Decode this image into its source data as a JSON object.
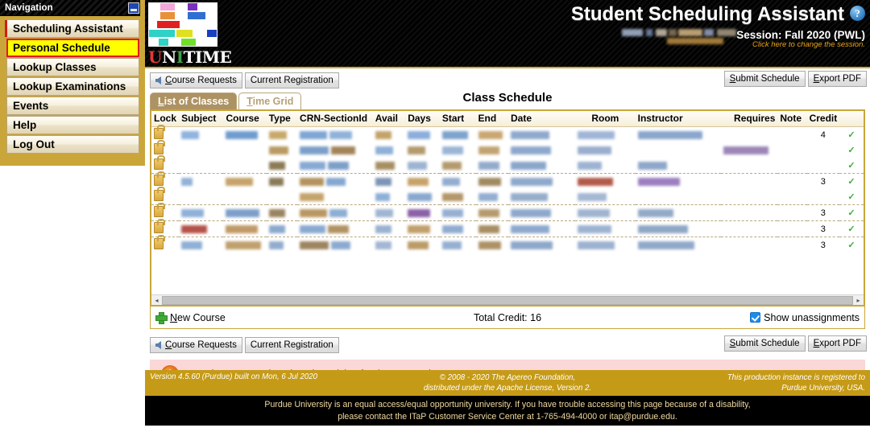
{
  "nav": {
    "title": "Navigation",
    "minimize_icon": "minimize-icon",
    "items": [
      {
        "label": "Scheduling Assistant",
        "selected": false
      },
      {
        "label": "Personal Schedule",
        "selected": true
      },
      {
        "label": "Lookup Classes",
        "selected": false
      },
      {
        "label": "Lookup Examinations",
        "selected": false
      },
      {
        "label": "Events",
        "selected": false
      },
      {
        "label": "Help",
        "selected": false
      },
      {
        "label": "Log Out",
        "selected": false
      }
    ]
  },
  "header": {
    "logo_text_parts": [
      "U",
      "N",
      "I",
      "T",
      "IME"
    ],
    "logo_text": "UniTime",
    "app_title": "Student Scheduling Assistant",
    "help_icon": "?",
    "session_label": "Session: Fall 2020 (PWL)",
    "session_sub": "Click here to change the session.",
    "accent_color": "#caa63a"
  },
  "toolbar_top": {
    "back_icon": "arrow-left-icon",
    "course_requests": "Course Requests",
    "course_requests_accel": "C",
    "current_registration": "Current Registration",
    "submit_schedule": "Submit Schedule",
    "submit_schedule_accel": "S",
    "export_pdf": "Export PDF",
    "export_pdf_accel": "E"
  },
  "tabs": {
    "list_of_classes": "List of Classes",
    "list_of_classes_accel": "L",
    "time_grid": "Time Grid",
    "time_grid_accel": "T",
    "active": "List of Classes"
  },
  "page_title": "Class Schedule",
  "table": {
    "columns": [
      "Lock",
      "Subject",
      "Course",
      "Type",
      "CRN-SectionId",
      "Avail",
      "Days",
      "Start",
      "End",
      "Date",
      "Room",
      "Instructor",
      "Requires",
      "Note",
      "Credit"
    ],
    "rows": [
      {
        "lock": "lock-icon",
        "credit": "4",
        "assigned": "✓",
        "group_start": true
      },
      {
        "lock": "lock-icon",
        "credit": "",
        "assigned": "✓",
        "group_start": false
      },
      {
        "lock": "lock-icon",
        "credit": "",
        "assigned": "✓",
        "group_start": false
      },
      {
        "lock": "lock-icon",
        "credit": "3",
        "assigned": "✓",
        "group_start": true
      },
      {
        "lock": "lock-icon",
        "credit": "",
        "assigned": "✓",
        "group_start": false
      },
      {
        "lock": "lock-icon",
        "credit": "3",
        "assigned": "✓",
        "group_start": true
      },
      {
        "lock": "lock-icon",
        "credit": "3",
        "assigned": "✓",
        "group_start": true
      },
      {
        "lock": "lock-icon",
        "credit": "3",
        "assigned": "✓",
        "group_start": true
      }
    ],
    "scrollbar": {
      "left_arrow": "◂",
      "right_arrow": "▸"
    }
  },
  "panel_footer": {
    "new_course_icon": "plus-icon",
    "new_course": "New Course",
    "new_course_accel": "N",
    "total_credit": "Total Credit: 16",
    "show_unassignments": "Show unassignments",
    "show_unassignments_checked": true
  },
  "toolbar_bottom": {
    "back_icon": "arrow-left-icon",
    "course_requests": "Course Requests",
    "current_registration": "Current Registration",
    "submit_schedule": "Submit Schedule",
    "export_pdf": "Export PDF"
  },
  "message": {
    "icon": "warning-icon",
    "text": "You have no Registration Time Ticket for the current time.",
    "background": "#fbd7d7"
  },
  "footer": {
    "version": "Version 4.5.60 (Purdue) built on Mon, 6 Jul 2020",
    "copyright_line1": "© 2008 - 2020 The Apereo Foundation,",
    "copyright_line2": "distributed under the Apache License, Version 2.",
    "registered_line1": "This production instance is registered to",
    "registered_line2": "Purdue University, USA.",
    "background": "#c59a17"
  },
  "disclaimer": {
    "line1": "Purdue University is an equal access/equal opportunity university. If you have trouble accessing this page because of a disability,",
    "line2": "please contact the ITaP Customer Service Center at 1-765-494-4000 or itap@purdue.edu."
  }
}
